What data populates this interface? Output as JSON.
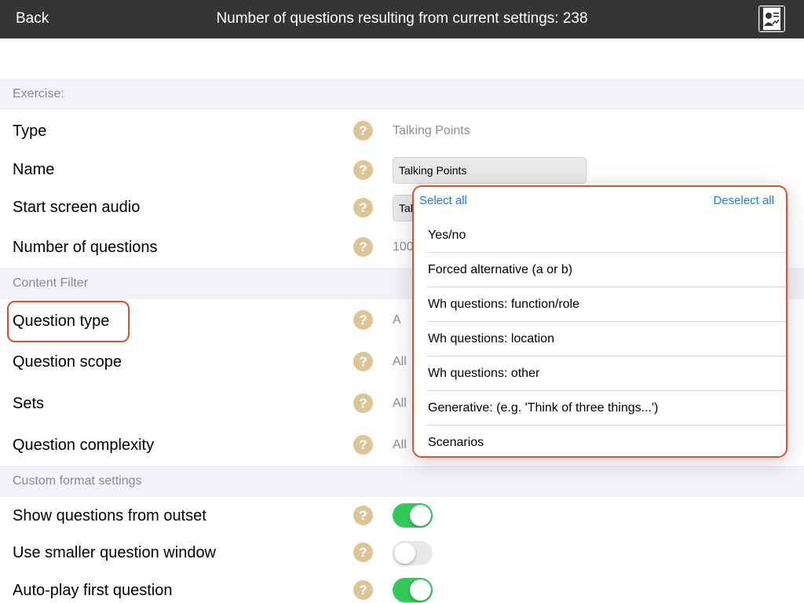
{
  "topbar": {
    "back_label": "Back",
    "title": "Number of questions resulting from current settings: 238",
    "icon": "profile-card-icon"
  },
  "sections": {
    "exercise": "Exercise:",
    "content_filter": "Content Filter",
    "custom_format": "Custom format settings"
  },
  "help_glyph": "?",
  "exercise": {
    "type_label": "Type",
    "type_value": "Talking Points",
    "name_label": "Name",
    "name_value": "Talking Points",
    "audio_label": "Start screen audio",
    "audio_value_partial": "Tal",
    "num_questions_label": "Number of questions",
    "num_questions_value_partial": "100"
  },
  "content_filter": {
    "question_type_label": "Question type",
    "question_type_value_partial": "A",
    "question_scope_label": "Question scope",
    "question_scope_value": "All",
    "sets_label": "Sets",
    "sets_value": "All",
    "complexity_label": "Question complexity",
    "complexity_value": "All"
  },
  "custom_format": {
    "show_questions_label": "Show questions from outset",
    "show_questions_on": true,
    "smaller_window_label": "Use smaller question window",
    "smaller_window_on": false,
    "autoplay_label": "Auto-play first question",
    "autoplay_on": true
  },
  "popover": {
    "select_all": "Select all",
    "deselect_all": "Deselect all",
    "options": [
      "Yes/no",
      "Forced alternative (a or b)",
      "Wh questions: function/role",
      "Wh questions: location",
      "Wh questions: other",
      "Generative: (e.g. 'Think of three things...')",
      "Scenarios"
    ]
  },
  "colors": {
    "topbar": "#353535",
    "accent_link": "#1a7fd4",
    "highlight_outline": "#e25028",
    "help_icon": "#dcc697",
    "toggle_on": "#34c759",
    "toggle_off": "#e9e9eb"
  }
}
